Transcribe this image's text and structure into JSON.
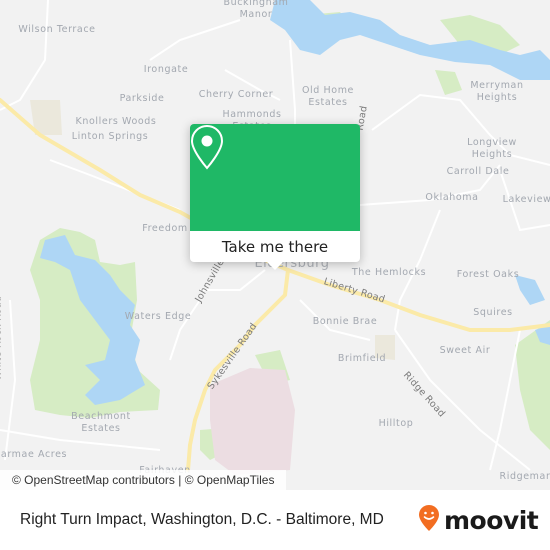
{
  "map": {
    "places": [
      {
        "id": "wilson-terrace",
        "label": "Wilson Terrace"
      },
      {
        "id": "buckingham-manor",
        "label": "Buckingham\nManor"
      },
      {
        "id": "irongate",
        "label": "Irongate"
      },
      {
        "id": "parkside",
        "label": "Parkside"
      },
      {
        "id": "cherry-corner",
        "label": "Cherry Corner"
      },
      {
        "id": "old-home-estates",
        "label": "Old Home\nEstates"
      },
      {
        "id": "hammonds-estates",
        "label": "Hammonds\nEstates"
      },
      {
        "id": "knollers-woods",
        "label": "Knollers Woods"
      },
      {
        "id": "linton-springs",
        "label": "Linton Springs"
      },
      {
        "id": "merryman-heights",
        "label": "Merryman\nHeights"
      },
      {
        "id": "longview-heights",
        "label": "Longview\nHeights"
      },
      {
        "id": "carroll-dale",
        "label": "Carroll Dale"
      },
      {
        "id": "oklahoma",
        "label": "Oklahoma"
      },
      {
        "id": "lakeview",
        "label": "Lakeview"
      },
      {
        "id": "freedom",
        "label": "Freedom"
      },
      {
        "id": "the-hemlocks",
        "label": "The Hemlocks"
      },
      {
        "id": "forest-oaks",
        "label": "Forest Oaks"
      },
      {
        "id": "waters-edge",
        "label": "Waters Edge"
      },
      {
        "id": "bonnie-brae",
        "label": "Bonnie Brae"
      },
      {
        "id": "squires",
        "label": "Squires"
      },
      {
        "id": "sweet-air",
        "label": "Sweet Air"
      },
      {
        "id": "brimfield",
        "label": "Brimfield"
      },
      {
        "id": "hilltop",
        "label": "Hilltop"
      },
      {
        "id": "beachmont-estates",
        "label": "Beachmont\nEstates"
      },
      {
        "id": "carmae-acres",
        "label": "armae Acres"
      },
      {
        "id": "ridgemar",
        "label": "Ridgemar"
      },
      {
        "id": "fairhaven",
        "label": "Fairhaven"
      }
    ],
    "town": "Eldersburg",
    "roads": {
      "liberty": "Liberty Road",
      "sykesville": "Sykesville Road",
      "johnsville": "Johnsville",
      "ridge": "Ridge Road",
      "white_rock": "White Rock Road",
      "old_road": "Road"
    },
    "attribution": "© OpenStreetMap contributors | © OpenMapTiles"
  },
  "popup": {
    "icon": "map-pin-icon",
    "cta_label": "Take me there",
    "color": "#1fb866"
  },
  "footer": {
    "title": "Right Turn Impact, Washington, D.C. - Baltimore, MD",
    "logo_text": "moovit",
    "logo_color": "#f26d21"
  }
}
